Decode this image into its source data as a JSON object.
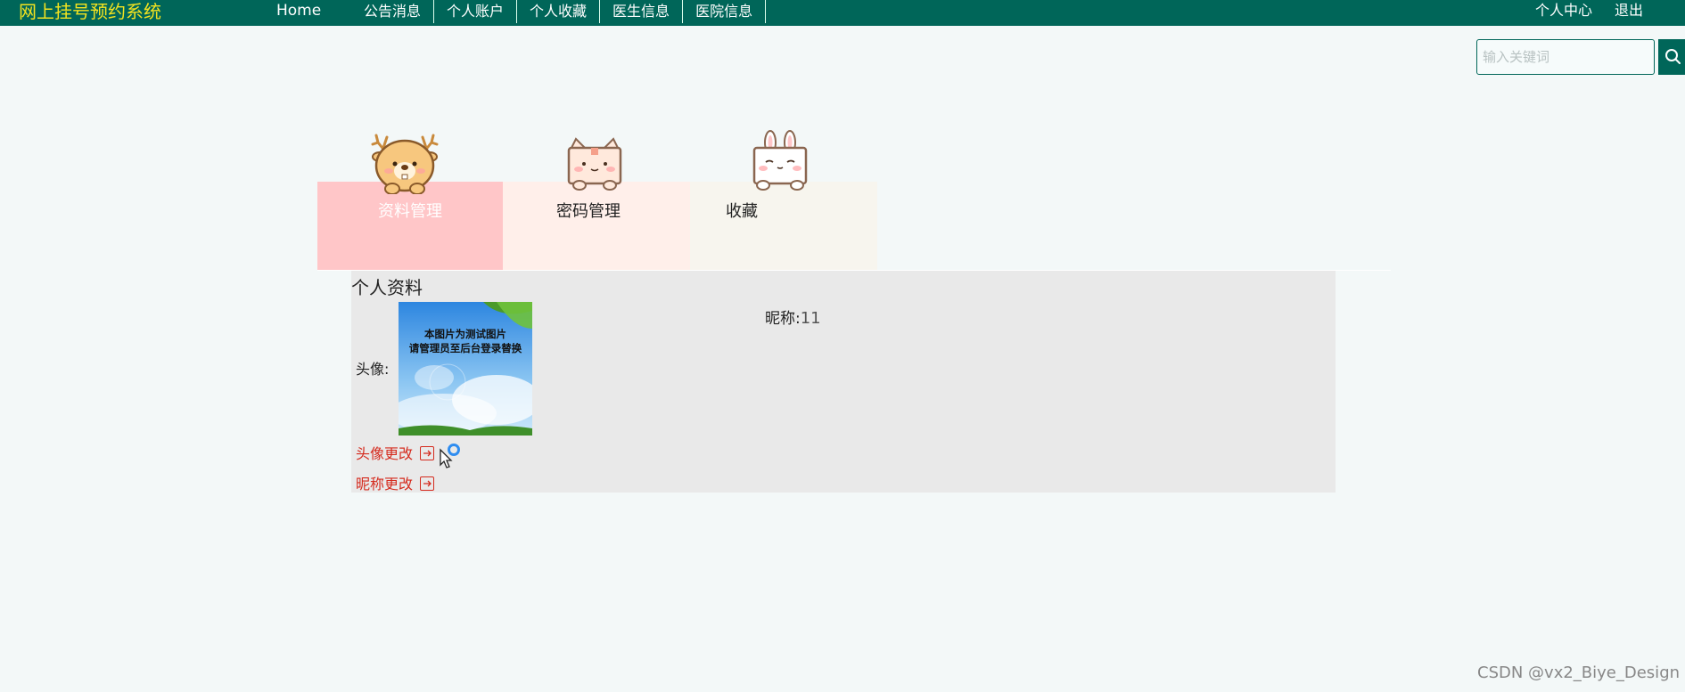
{
  "header": {
    "site_title": "网上挂号预约系统",
    "home": "Home",
    "nav": [
      "公告消息",
      "个人账户",
      "个人收藏",
      "医生信息",
      "医院信息"
    ],
    "user_center": "个人中心",
    "logout": "退出",
    "bar_color": "#006659",
    "title_color": "#f2e31f"
  },
  "search": {
    "placeholder": "输入关键词",
    "icon": "search-icon"
  },
  "tabs": [
    {
      "label": "资料管理",
      "mascot": "deer-icon",
      "color": "#ffc6c8",
      "active": true
    },
    {
      "label": "密码管理",
      "mascot": "cat-icon",
      "color": "#ffefea"
    },
    {
      "label": "收藏",
      "mascot": "rabbit-icon",
      "color": "#f7f5ee"
    }
  ],
  "profile": {
    "title": "个人资料",
    "avatar_label": "头像:",
    "avatar_image_text": [
      "本图片为测试图片",
      "请管理员至后台登录替换"
    ],
    "nickname_label": "昵称:",
    "nickname_value": "11",
    "change_avatar": "头像更改",
    "change_nickname": "昵称更改",
    "link_color": "#d52b1e"
  },
  "watermark": "CSDN @vx2_Biye_Design"
}
